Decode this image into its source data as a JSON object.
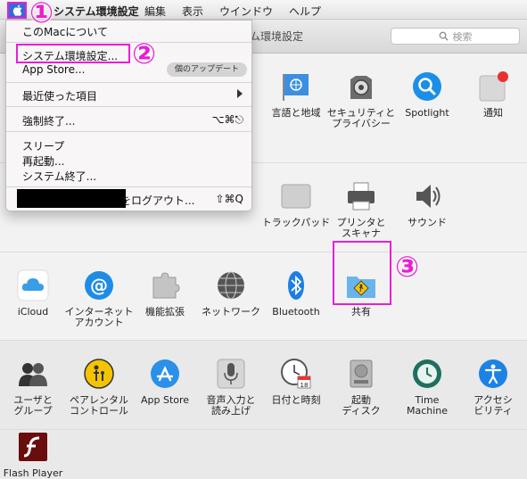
{
  "menubar": {
    "app_name": "システム環境設定",
    "items": [
      "編集",
      "表示",
      "ウインドウ",
      "ヘルプ"
    ]
  },
  "window": {
    "title": "ム環境設定",
    "search_placeholder": "検索"
  },
  "apple_menu": {
    "about": "このMacについて",
    "system_prefs": "システム環境設定...",
    "app_store": "App Store...",
    "updates_badge": "個のアップデート",
    "recent": "最近使った項目",
    "force_quit": "強制終了...",
    "force_quit_shortcut": "⌥⌘⎋",
    "sleep": "スリープ",
    "restart": "再起動...",
    "shutdown": "システム終了...",
    "logout_suffix": "をログアウト...",
    "logout_shortcut": "⇧⌘Q"
  },
  "panes": {
    "row1": [
      {
        "label": "言語と地域",
        "icon": "un-flag-icon"
      },
      {
        "label": "セキュリティと\nプライバシー",
        "icon": "security-icon"
      },
      {
        "label": "Spotlight",
        "icon": "spotlight-icon"
      },
      {
        "label": "通知",
        "icon": "notification-icon"
      }
    ],
    "row2": [
      {
        "label": "トラックパッド",
        "icon": "trackpad-icon"
      },
      {
        "label": "プリンタと\nスキャナ",
        "icon": "printer-icon"
      },
      {
        "label": "サウンド",
        "icon": "speaker-icon"
      }
    ],
    "row3": [
      {
        "label": "iCloud",
        "icon": "icloud-icon"
      },
      {
        "label": "インターネット\nアカウント",
        "icon": "at-icon"
      },
      {
        "label": "機能拡張",
        "icon": "puzzle-icon"
      },
      {
        "label": "ネットワーク",
        "icon": "globe-icon"
      },
      {
        "label": "Bluetooth",
        "icon": "bluetooth-icon"
      },
      {
        "label": "共有",
        "icon": "sharing-folder-icon"
      }
    ],
    "row4": [
      {
        "label": "ユーザと\nグループ",
        "icon": "users-icon"
      },
      {
        "label": "ペアレンタル\nコントロール",
        "icon": "parental-icon"
      },
      {
        "label": "App Store",
        "icon": "appstore-icon"
      },
      {
        "label": "音声入力と\n読み上げ",
        "icon": "microphone-icon"
      },
      {
        "label": "日付と時刻",
        "icon": "clock-calendar-icon"
      },
      {
        "label": "起動\nディスク",
        "icon": "disk-icon"
      },
      {
        "label": "Time\nMachine",
        "icon": "time-machine-icon"
      },
      {
        "label": "アクセシ\nビリティ",
        "icon": "accessibility-icon"
      }
    ],
    "row5": [
      {
        "label": "Flash Player",
        "icon": "flash-icon"
      }
    ]
  },
  "annotations": {
    "step1": "①",
    "step2": "②",
    "step3": "③",
    "color": "#e91ed6"
  },
  "calendar_day": "18"
}
